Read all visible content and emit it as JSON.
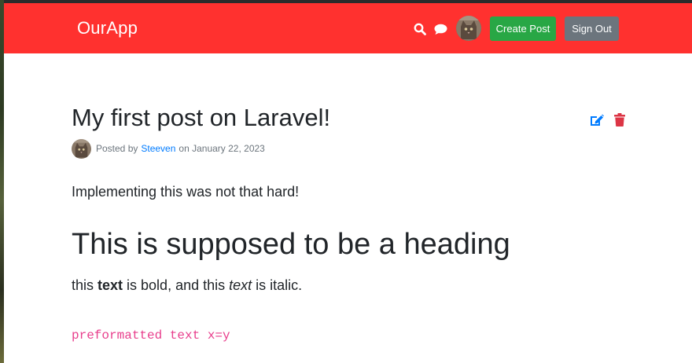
{
  "header": {
    "brand": "OurApp",
    "search_icon": "search-icon",
    "chat_icon": "chat-icon",
    "avatar_icon": "user-avatar",
    "create_post_label": "Create Post",
    "sign_out_label": "Sign Out",
    "bg_color": "#ff312f"
  },
  "post": {
    "title": "My first post on Laravel!",
    "edit_icon": "edit-icon",
    "delete_icon": "trash-icon",
    "meta": {
      "posted_by_prefix": "Posted by",
      "author": "Steeven",
      "date_text": "on January 22, 2023"
    },
    "body": {
      "paragraph1": "Implementing this was not that hard!",
      "heading": "This is supposed to be a heading",
      "p2_part1": "this ",
      "p2_bold": "text",
      "p2_part2": " is bold, and this ",
      "p2_italic": "text",
      "p2_part3": " is italic.",
      "preformatted": "preformatted text x=y"
    }
  },
  "colors": {
    "create_button": "#28a745",
    "sign_out_button": "#6c757d",
    "link": "#007bff",
    "edit_icon": "#007bff",
    "delete_icon": "#dc3545",
    "code": "#e83e8c"
  }
}
